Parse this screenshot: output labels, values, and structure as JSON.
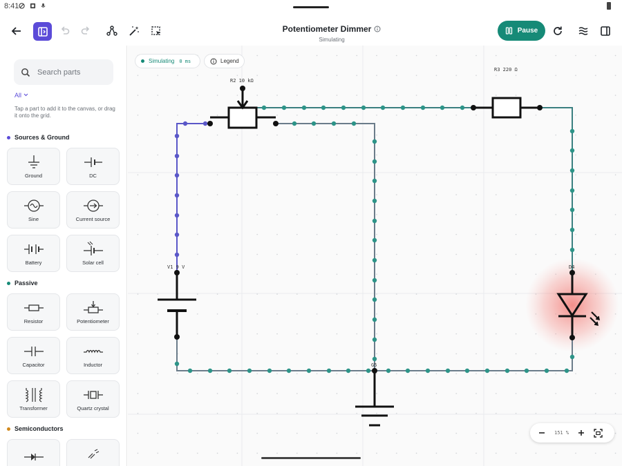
{
  "status_bar": {
    "time": "8:41"
  },
  "toolbar": {
    "title": "Potentiometer Dimmer",
    "subtitle": "Simulating",
    "pause_label": "Pause",
    "accent_color": "#5b4bd8",
    "pause_color": "#168a77"
  },
  "sidebar": {
    "search_placeholder": "Search parts",
    "filter_label": "All",
    "hint": "Tap a part to add it to the canvas, or drag it onto the grid.",
    "sections": [
      {
        "label": "Sources & Ground",
        "color": "#5b4bd8"
      },
      {
        "label": "Passive",
        "color": "#168a77"
      },
      {
        "label": "Semiconductors",
        "color": "#d2891c"
      }
    ],
    "parts": [
      {
        "label": "Ground",
        "icon": "ground-icon"
      },
      {
        "label": "DC",
        "icon": "dc-source-icon"
      },
      {
        "label": "Sine",
        "icon": "sine-source-icon"
      },
      {
        "label": "Current source",
        "icon": "current-source-icon"
      },
      {
        "label": "Battery",
        "icon": "battery-icon"
      },
      {
        "label": "Solar cell",
        "icon": "solar-cell-icon"
      },
      {
        "label": "Resistor",
        "icon": "resistor-icon"
      },
      {
        "label": "Potentiometer",
        "icon": "potentiometer-icon"
      },
      {
        "label": "Capacitor",
        "icon": "capacitor-icon"
      },
      {
        "label": "Inductor",
        "icon": "inductor-icon"
      },
      {
        "label": "Transformer",
        "icon": "transformer-icon"
      },
      {
        "label": "Quartz crystal",
        "icon": "quartz-crystal-icon"
      }
    ]
  },
  "canvas": {
    "sim_chip_label": "Simulating",
    "sim_time": "0 ms",
    "legend_label": "Legend",
    "components": {
      "pot": "R2 10 kΩ",
      "resistor": "R3 220 Ω",
      "battery": "V1 9 V",
      "led": "D4",
      "ground": "G5"
    },
    "zoom": {
      "value": "151",
      "unit": "%"
    }
  }
}
